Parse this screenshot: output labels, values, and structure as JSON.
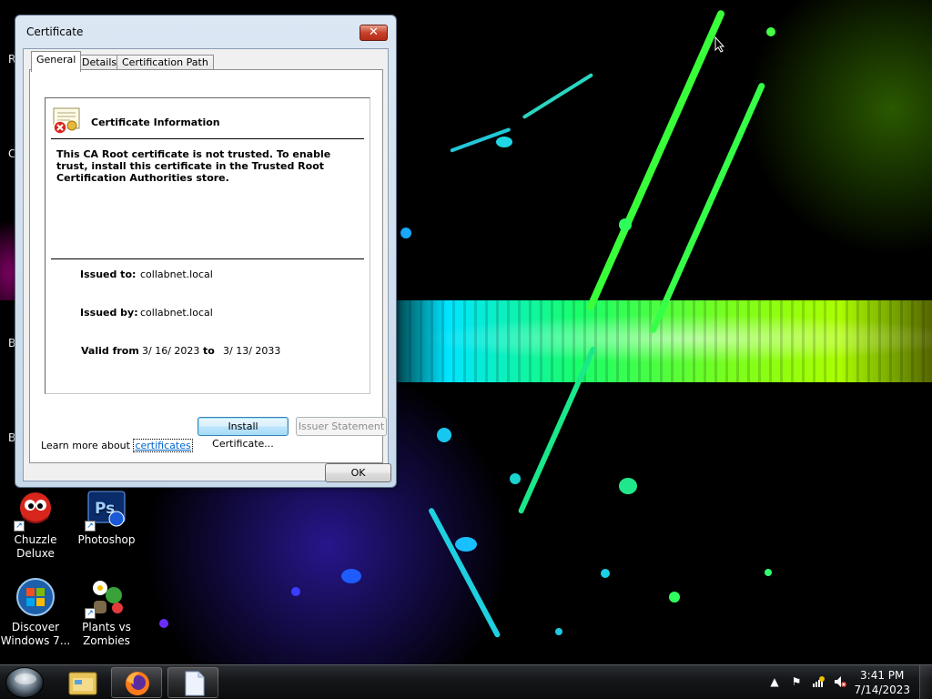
{
  "window": {
    "title": "Certificate",
    "close_glyph": "✕",
    "tabs": [
      {
        "label": "General",
        "active": true
      },
      {
        "label": "Details",
        "active": false
      },
      {
        "label": "Certification Path",
        "active": false
      }
    ],
    "info": {
      "heading": "Certificate Information",
      "icon": "certificate-error-icon",
      "message": "This CA Root certificate is not trusted. To enable trust, install this certificate in the Trusted Root Certification Authorities store.",
      "issued_to_label": "Issued to:",
      "issued_to_value": "collabnet.local",
      "issued_by_label": "Issued by:",
      "issued_by_value": "collabnet.local",
      "valid_from_label": "Valid from",
      "valid_from_value": "3/ 16/ 2023",
      "valid_to_label": "to",
      "valid_to_value": "3/ 13/ 2033"
    },
    "buttons": {
      "install": "Install Certificate...",
      "issuer_statement": "Issuer Statement",
      "ok": "OK"
    },
    "learn_more_prefix": "Learn more about",
    "learn_more_link": "certificates"
  },
  "desktop": {
    "edge_letters": [
      "R",
      "C",
      "B",
      "B"
    ],
    "icons": [
      {
        "label": "Chuzzle Deluxe",
        "icon": "chuzzle-icon"
      },
      {
        "label": "Photoshop",
        "icon": "photoshop-icon",
        "glyph": "Ps"
      },
      {
        "label": "Discover Windows 7...",
        "icon": "windows-logo-icon"
      },
      {
        "label": "Plants vs Zombies",
        "icon": "plants-vs-zombies-icon"
      }
    ]
  },
  "taskbar": {
    "pinned": [
      "windows-explorer-icon",
      "firefox-icon",
      "document-icon"
    ],
    "tray_icons": [
      "show-hidden-icons-icon",
      "action-center-flag-icon",
      "network-icon",
      "volume-muted-icon"
    ],
    "tray_glyphs": {
      "arrow": "▲",
      "flag": "⚑"
    },
    "clock_time": "3:41 PM",
    "clock_date": "7/14/2023"
  },
  "colors": {
    "window_frame": "#c8d9ea",
    "close_button": "#c8412b",
    "link": "#0066cc",
    "taskbar": "#15171a"
  }
}
